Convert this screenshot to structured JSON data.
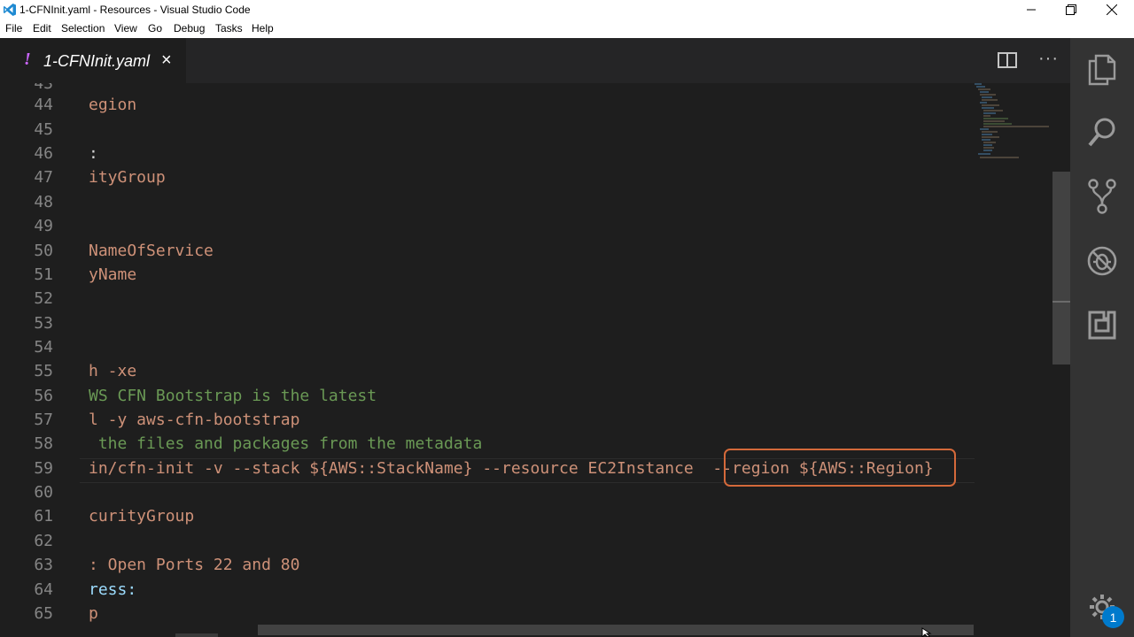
{
  "window": {
    "title": "1-CFNInit.yaml - Resources - Visual Studio Code",
    "controls": [
      "minimize-icon",
      "restore-icon",
      "close-icon"
    ]
  },
  "menu": {
    "file": "File",
    "edit": "Edit",
    "selection": "Selection",
    "view": "View",
    "go": "Go",
    "debug": "Debug",
    "tasks": "Tasks",
    "help": "Help"
  },
  "tab": {
    "indicator": "!",
    "filename": "1-CFNInit.yaml",
    "close": "×"
  },
  "editor_actions": {
    "more": "···"
  },
  "activity_bar": {
    "icons": [
      "explorer-icon",
      "search-icon",
      "source-control-icon",
      "debug-icon",
      "extensions-icon",
      "settings-gear-icon"
    ],
    "settings_badge": "1"
  },
  "lines": [
    {
      "n": "44",
      "text": "egion"
    },
    {
      "n": "45",
      "text": ""
    },
    {
      "n": "46",
      "text": ":"
    },
    {
      "n": "47",
      "text": "ityGroup"
    },
    {
      "n": "48",
      "text": ""
    },
    {
      "n": "49",
      "text": ""
    },
    {
      "n": "50",
      "text": "NameOfService"
    },
    {
      "n": "51",
      "text": "yName"
    },
    {
      "n": "52",
      "text": ""
    },
    {
      "n": "53",
      "text": ""
    },
    {
      "n": "54",
      "text": ""
    },
    {
      "n": "55",
      "text": "h -xe"
    },
    {
      "n": "56",
      "text": "WS CFN Bootstrap is the latest"
    },
    {
      "n": "57",
      "text": "l -y aws-cfn-bootstrap"
    },
    {
      "n": "58",
      "text": " the files and packages from the metadata"
    },
    {
      "n": "59",
      "text": "in/cfn-init -v --stack ${AWS::StackName} --resource EC2Instance  --region ${AWS::Region}"
    },
    {
      "n": "60",
      "text": ""
    },
    {
      "n": "61",
      "text": "curityGroup"
    },
    {
      "n": "62",
      "text": ""
    },
    {
      "n": "63",
      "text": ": Open Ports 22 and 80"
    },
    {
      "n": "64",
      "text": "ress:"
    },
    {
      "n": "65",
      "text": "p"
    }
  ],
  "highlight": {
    "text": "--region ${AWS::Region}",
    "color": "#d4693a"
  },
  "colors": {
    "string": "#ce9178",
    "comment": "#6a9955",
    "key": "#9cdcfe",
    "line_number": "#858585",
    "background": "#1e1e1e",
    "activity_bar": "#333333",
    "badge": "#007acc"
  }
}
